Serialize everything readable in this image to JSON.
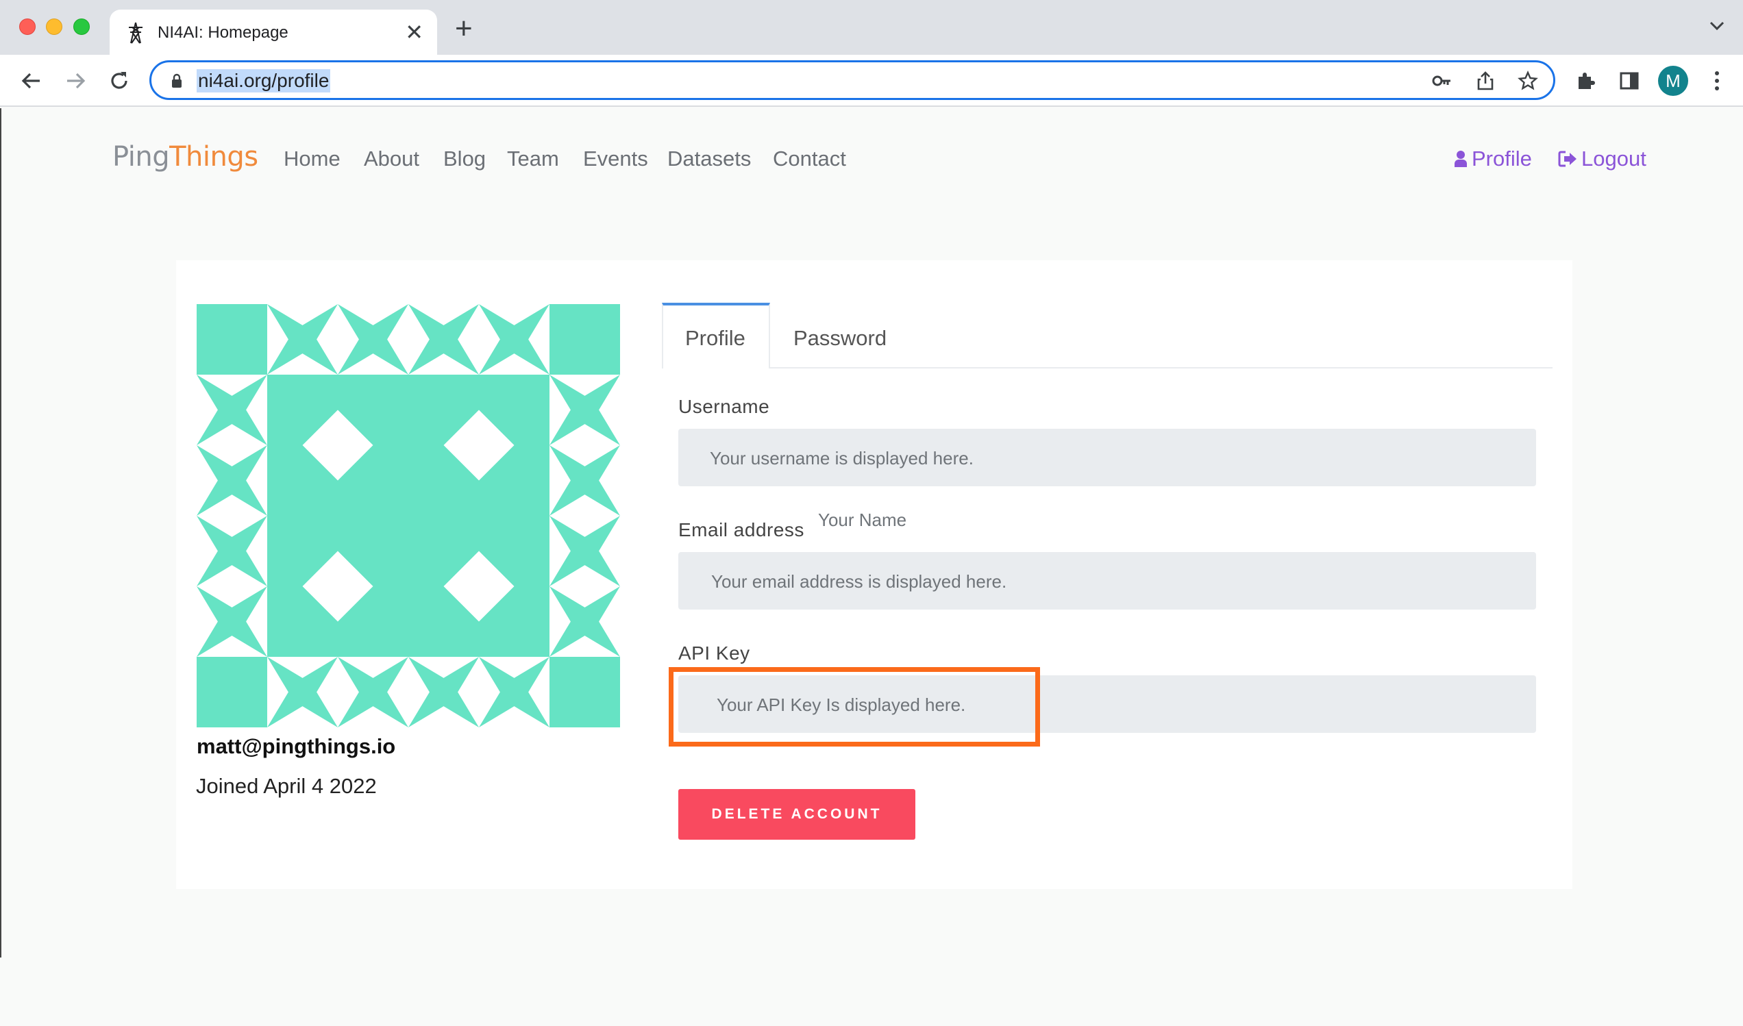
{
  "browser": {
    "tab_title": "NI4AI: Homepage",
    "tab_close": "✕",
    "new_tab": "+",
    "url": "ni4ai.org/profile",
    "avatar_letter": "M"
  },
  "site": {
    "logo_part1": "Ping",
    "logo_part2": "Things",
    "nav": [
      "Home",
      "About",
      "Blog",
      "Team",
      "Events",
      "Datasets",
      "Contact"
    ],
    "profile_link": "Profile",
    "logout_link": "Logout"
  },
  "profile_card": {
    "email": "matt@pingthings.io",
    "joined": "Joined April 4 2022",
    "identicon_color": "#66e3c4"
  },
  "tabs": {
    "profile": "Profile",
    "password": "Password"
  },
  "form": {
    "username_label": "Username",
    "username_placeholder": "Your username is displayed here.",
    "stray_text": "Your Name",
    "email_label": "Email address",
    "email_placeholder": "Your email address is displayed here.",
    "apikey_label": "API Key",
    "apikey_placeholder": "Your API Key Is displayed here.",
    "delete_button": "DELETE ACCOUNT"
  },
  "colors": {
    "accent_purple": "#8b54d8",
    "highlight_orange": "#fb6a1a",
    "danger_red": "#f94a5f",
    "logo_orange": "#f08a3c"
  }
}
